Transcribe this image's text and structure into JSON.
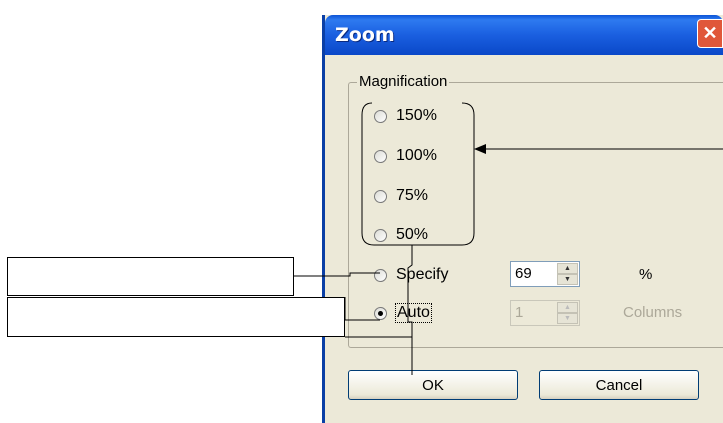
{
  "dialog": {
    "title": "Zoom",
    "close_icon": "close-x-icon"
  },
  "magnification": {
    "group_label": "Magnification",
    "options": [
      {
        "label": "150%",
        "selected": false
      },
      {
        "label": "100%",
        "selected": false
      },
      {
        "label": "75%",
        "selected": false
      },
      {
        "label": "50%",
        "selected": false
      },
      {
        "label": "Specify",
        "selected": false
      },
      {
        "label": "Auto",
        "selected": true
      }
    ],
    "specify_value": "69",
    "specify_unit": "%",
    "columns_value": "1",
    "columns_label": "Columns"
  },
  "buttons": {
    "ok": "OK",
    "cancel": "Cancel"
  }
}
